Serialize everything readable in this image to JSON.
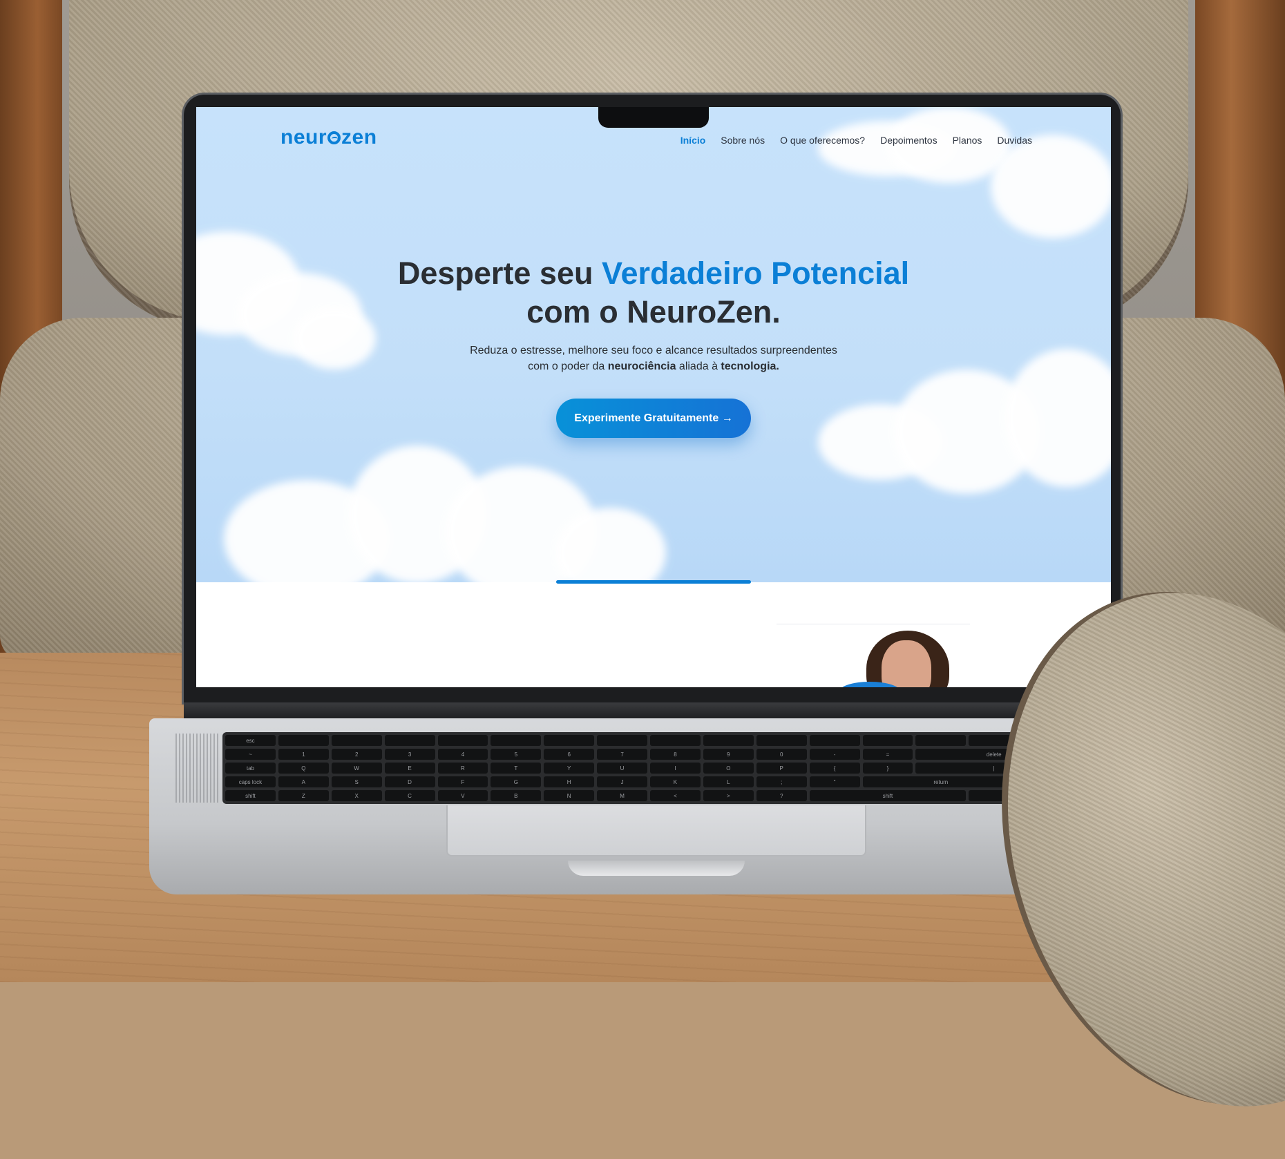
{
  "site": {
    "logo_prefix": "neur",
    "logo_suffix": "zen",
    "nav": [
      {
        "label": "Início",
        "active": true
      },
      {
        "label": "Sobre nós",
        "active": false
      },
      {
        "label": "O que oferecemos?",
        "active": false
      },
      {
        "label": "Depoimentos",
        "active": false
      },
      {
        "label": "Planos",
        "active": false
      },
      {
        "label": "Duvidas",
        "active": false
      }
    ]
  },
  "hero": {
    "headline_part1": "Desperte seu ",
    "headline_accent": "Verdadeiro Potencial",
    "headline_part2": "com o NeuroZen.",
    "sub_line1": "Reduza o estresse, melhore seu foco e alcance resultados surpreendentes",
    "sub_line2_pre": "com o poder da ",
    "sub_bold1": "neurociência",
    "sub_mid": " aliada à ",
    "sub_bold2": "tecnologia.",
    "cta_label": "Experimente Gratuitamente →"
  },
  "colors": {
    "brand": "#0b7fd6",
    "hero_bg": "#c7e2fb",
    "text": "#2a2e33"
  },
  "icons": [
    "logo-o-icon",
    "arrow-right-icon"
  ]
}
